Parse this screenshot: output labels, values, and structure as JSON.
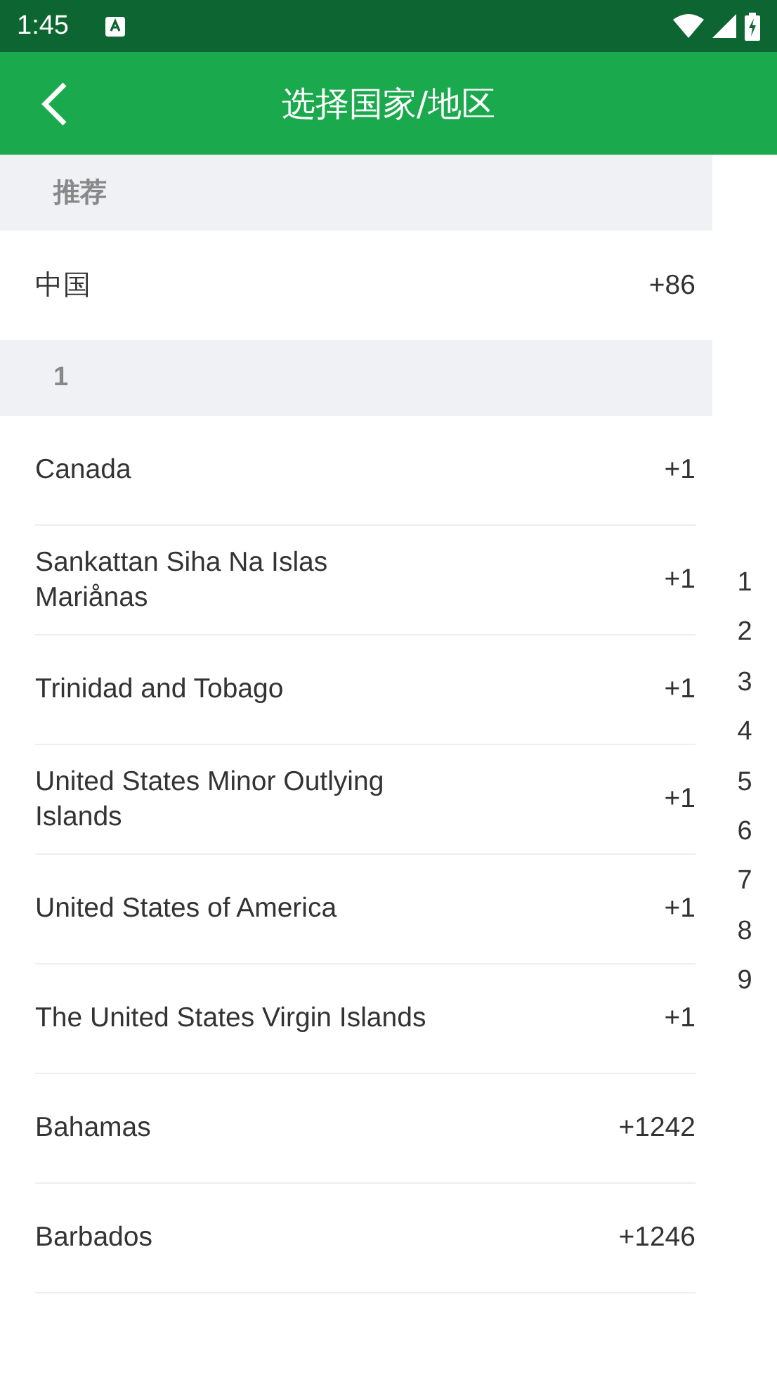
{
  "status_bar": {
    "time": "1:45"
  },
  "header": {
    "title": "选择国家/地区"
  },
  "sections": [
    {
      "title": "推荐",
      "rows": [
        {
          "name": "中国",
          "code": "+86"
        }
      ]
    },
    {
      "title": "1",
      "rows": [
        {
          "name": "Canada",
          "code": "+1"
        },
        {
          "name": "Sankattan Siha Na Islas Mariånas",
          "code": "+1"
        },
        {
          "name": "Trinidad and Tobago",
          "code": "+1"
        },
        {
          "name": "United States Minor Outlying Islands",
          "code": "+1"
        },
        {
          "name": "United States of America",
          "code": "+1"
        },
        {
          "name": "The United States Virgin Islands",
          "code": "+1"
        },
        {
          "name": "Bahamas",
          "code": "+1242"
        },
        {
          "name": "Barbados",
          "code": "+1246"
        }
      ]
    }
  ],
  "index_bar": [
    "1",
    "2",
    "3",
    "4",
    "5",
    "6",
    "7",
    "8",
    "9"
  ]
}
